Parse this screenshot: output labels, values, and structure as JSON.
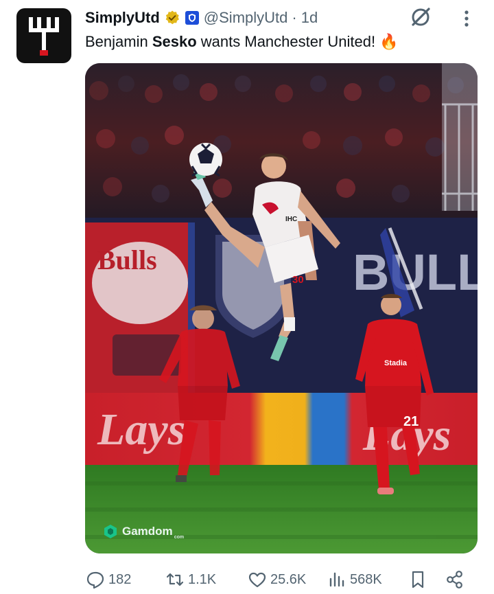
{
  "account": {
    "display_name": "SimplyUtd",
    "handle": "@SimplyUtd",
    "separator": "·",
    "timestamp": "1d",
    "avatar_icon": "trident-logo-icon",
    "verified_icon": "gold-verified-badge-icon",
    "affiliation_icon": "blue-shield-badge-icon"
  },
  "tweet": {
    "text_before": "Benjamin ",
    "text_bold": "Sesko",
    "text_after": " wants Manchester United!",
    "emoji": "🔥"
  },
  "media": {
    "description_icon": "football-photo",
    "watermark": "Gamdom",
    "watermark_sub": "com",
    "ad_board_left": "Lays",
    "ad_board_right": "Lays",
    "banner_left": "Bulls",
    "banner_mid": "BULL",
    "shirt_number_main": "30",
    "shirt_number_right": "21",
    "sponsor": "IHC"
  },
  "actions": {
    "replies": "182",
    "reposts": "1.1K",
    "likes": "25.6K",
    "views": "568K"
  },
  "colors": {
    "text": "#0f1419",
    "secondary": "#536471",
    "verified_gold": "#e2b719",
    "affiliate_blue": "#1d4ed8",
    "pitch_green": "#3f8a2e",
    "liverpool_red": "#d6151f"
  }
}
